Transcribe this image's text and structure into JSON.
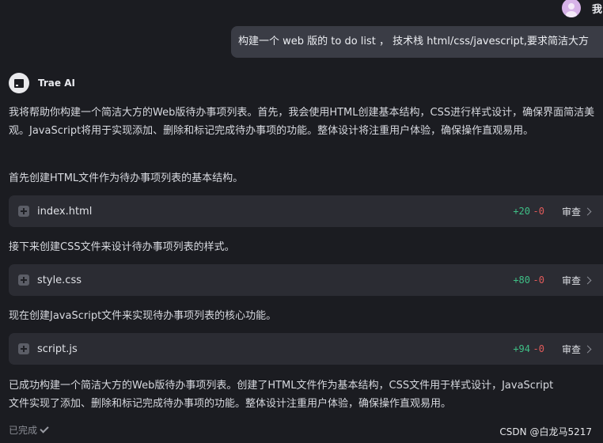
{
  "user": {
    "name": "我",
    "message": "构建一个 web 版的 to do list ， 技术栈 html/css/javescript,要求简洁大方"
  },
  "assistant": {
    "name": "Trae AI",
    "intro": "我将帮助你构建一个简洁大方的Web版待办事项列表。首先，我会使用HTML创建基本结构，CSS进行样式设计，确保界面简洁美观。JavaScript将用于实现添加、删除和标记完成待办事项的功能。整体设计将注重用户体验，确保操作直观易用。",
    "step1": "首先创建HTML文件作为待办事项列表的基本结构。",
    "step2": "接下来创建CSS文件来设计待办事项列表的样式。",
    "step3": "现在创建JavaScript文件来实现待办事项列表的核心功能。",
    "summary": "已成功构建一个简洁大方的Web版待办事项列表。创建了HTML文件作为基本结构，CSS文件用于样式设计，JavaScript文件实现了添加、删除和标记完成待办事项的功能。整体设计注重用户体验，确保操作直观易用。",
    "status": "已完成"
  },
  "files": [
    {
      "name": "index.html",
      "added": "+20",
      "removed": "-0",
      "review": "审查"
    },
    {
      "name": "style.css",
      "added": "+80",
      "removed": "-0",
      "review": "审查"
    },
    {
      "name": "script.js",
      "added": "+94",
      "removed": "-0",
      "review": "审查"
    }
  ],
  "watermark": "CSDN @白龙马5217",
  "icons": {
    "user_avatar": "user-avatar-icon",
    "ai_avatar": "trae-logo-icon",
    "expand": "plus-icon",
    "review": "chevron-right-icon",
    "done": "check-icon"
  },
  "colors": {
    "background": "#1b1c21",
    "bubble": "#3a3c45",
    "card": "#2b2c33",
    "added": "#3fbf86",
    "removed": "#e05a5a"
  }
}
